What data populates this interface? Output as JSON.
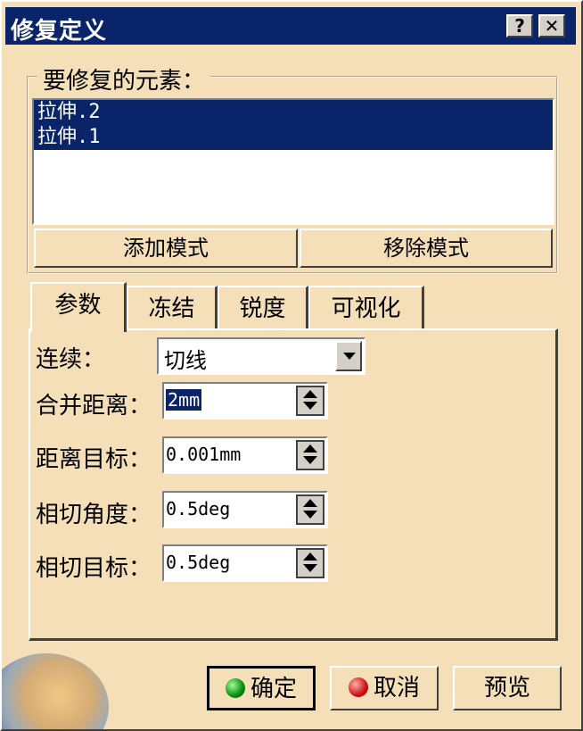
{
  "window": {
    "title": "修复定义",
    "help_label": "?",
    "close_label": "✕"
  },
  "elements_group": {
    "legend": "要修复的元素：",
    "items": [
      "拉伸.2",
      "拉伸.1"
    ],
    "add_mode_label": "添加模式",
    "remove_mode_label": "移除模式"
  },
  "tabs": [
    {
      "label": "参数",
      "active": true
    },
    {
      "label": "冻结",
      "active": false
    },
    {
      "label": "锐度",
      "active": false
    },
    {
      "label": "可视化",
      "active": false
    }
  ],
  "params": {
    "continuity": {
      "label": "连续：",
      "value": "切线"
    },
    "merge_distance": {
      "label": "合并距离：",
      "value": "2mm"
    },
    "distance_target": {
      "label": "距离目标：",
      "value": "0.001mm"
    },
    "tangency_angle": {
      "label": "相切角度：",
      "value": "0.5deg"
    },
    "tangency_target": {
      "label": "相切目标：",
      "value": "0.5deg"
    }
  },
  "buttons": {
    "ok": "确定",
    "cancel": "取消",
    "preview": "预览"
  },
  "colors": {
    "background": "#f5dfb9",
    "titlebar": "#0a246a",
    "selection": "#0a246a"
  },
  "icons": [
    "help-icon",
    "close-icon",
    "dropdown-arrow-icon",
    "spinner-icon",
    "green-dot-icon",
    "red-dot-icon"
  ]
}
